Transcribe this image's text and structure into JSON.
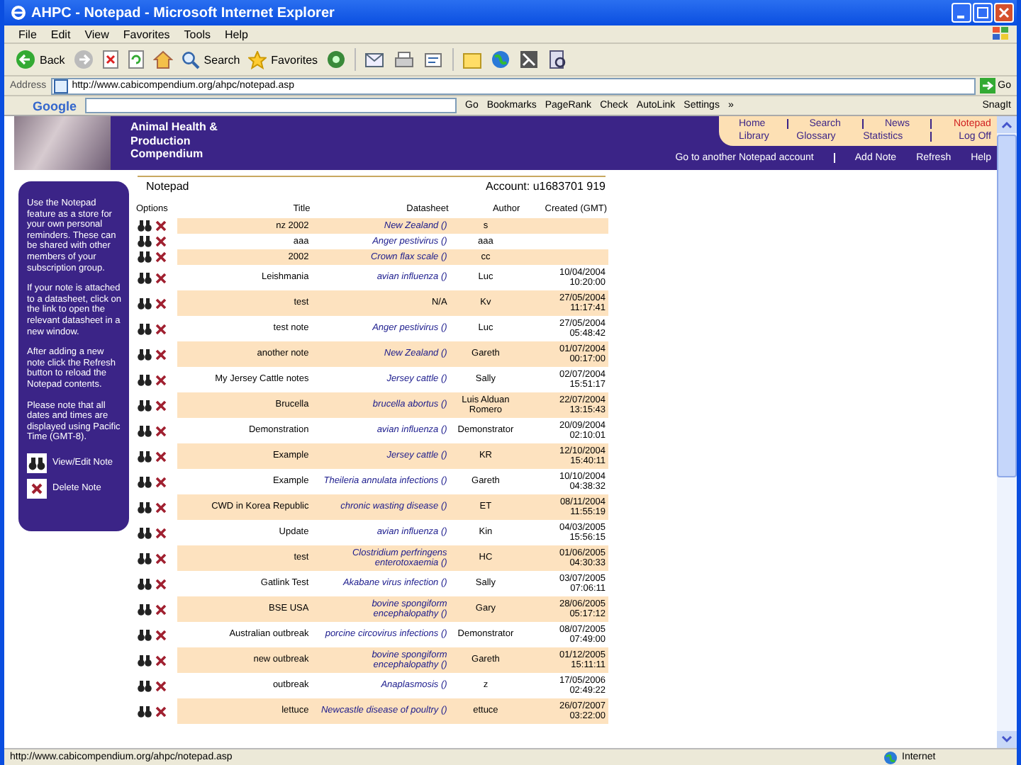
{
  "window": {
    "title": "AHPC - Notepad - Microsoft Internet Explorer"
  },
  "menu": [
    "File",
    "Edit",
    "View",
    "Favorites",
    "Tools",
    "Help"
  ],
  "toolbar": {
    "back": "Back",
    "search": "Search",
    "favorites": "Favorites"
  },
  "address": {
    "label": "Address",
    "url": "http://www.cabicompendium.org/ahpc/notepad.asp",
    "go": "Go"
  },
  "google_bar": {
    "logo": "Google",
    "go": "Go",
    "items": [
      "Bookmarks",
      "PageRank",
      "Check",
      "AutoLink",
      "Settings"
    ],
    "more": "»",
    "snagit": "SnagIt"
  },
  "site": {
    "name": "Animal Health & Production Compendium",
    "nav_top": [
      {
        "label": "Home",
        "selected": false
      },
      {
        "label": "Search",
        "selected": false
      },
      {
        "label": "News",
        "selected": false
      },
      {
        "label": "Notepad",
        "selected": true
      }
    ],
    "nav_bottom": [
      {
        "label": "Library",
        "selected": false
      },
      {
        "label": "Glossary",
        "selected": false
      },
      {
        "label": "Statistics",
        "selected": false
      },
      {
        "label": "Log Off",
        "selected": false
      }
    ],
    "actions": [
      "Go to another Notepad account",
      "Add Note",
      "Refresh",
      "Help"
    ]
  },
  "sidebar": {
    "paragraphs": [
      "Use the Notepad feature as a store for your own personal reminders. These can be shared with other members of your subscription group.",
      "If your note is attached to a datasheet, click on the link to open the relevant datasheet in a new window.",
      "After adding a new note click the Refresh button to reload the Notepad contents.",
      "Please note that all dates and times are displayed using Pacific Time (GMT-8)."
    ],
    "legend": {
      "view": "View/Edit Note",
      "delete": "Delete Note"
    }
  },
  "notepad": {
    "title": "Notepad",
    "account": "Account: u1683701 919",
    "columns": [
      "Options",
      "Title",
      "Datasheet",
      "Author",
      "Created (GMT)"
    ],
    "rows": [
      {
        "title": "nz 2002",
        "datasheet": "New Zealand ()",
        "linked": true,
        "author": "s",
        "created": ""
      },
      {
        "title": "aaa",
        "datasheet": "Anger pestivirus ()",
        "linked": true,
        "author": "aaa",
        "created": ""
      },
      {
        "title": "2002",
        "datasheet": "Crown flax scale ()",
        "linked": true,
        "author": "cc",
        "created": ""
      },
      {
        "title": "Leishmania",
        "datasheet": "avian influenza ()",
        "linked": true,
        "author": "Luc",
        "created": "10/04/2004 10:20:00"
      },
      {
        "title": "test",
        "datasheet": "N/A",
        "linked": false,
        "author": "Kv",
        "created": "27/05/2004 11:17:41"
      },
      {
        "title": "test note",
        "datasheet": "Anger pestivirus ()",
        "linked": true,
        "author": "Luc",
        "created": "27/05/2004 05:48:42"
      },
      {
        "title": "another note",
        "datasheet": "New Zealand ()",
        "linked": true,
        "author": "Gareth",
        "created": "01/07/2004 00:17:00"
      },
      {
        "title": "My Jersey Cattle notes",
        "datasheet": "Jersey cattle ()",
        "linked": true,
        "author": "Sally",
        "created": "02/07/2004 15:51:17"
      },
      {
        "title": "Brucella",
        "datasheet": "brucella abortus ()",
        "linked": true,
        "author": "Luis Alduan Romero",
        "created": "22/07/2004 13:15:43"
      },
      {
        "title": "Demonstration",
        "datasheet": "avian influenza ()",
        "linked": true,
        "author": "Demonstrator",
        "created": "20/09/2004 02:10:01"
      },
      {
        "title": "Example",
        "datasheet": "Jersey cattle ()",
        "linked": true,
        "author": "KR",
        "created": "12/10/2004 15:40:11"
      },
      {
        "title": "Example",
        "datasheet": "Theileria annulata infections ()",
        "linked": true,
        "author": "Gareth",
        "created": "10/10/2004 04:38:32"
      },
      {
        "title": "CWD in Korea Republic",
        "datasheet": "chronic wasting disease ()",
        "linked": true,
        "author": "ET",
        "created": "08/11/2004 11:55:19"
      },
      {
        "title": "Update",
        "datasheet": "avian influenza ()",
        "linked": true,
        "author": "Kin",
        "created": "04/03/2005 15:56:15"
      },
      {
        "title": "test",
        "datasheet": "Clostridium perfringens enterotoxaemia ()",
        "linked": true,
        "author": "HC",
        "created": "01/06/2005 04:30:33"
      },
      {
        "title": "Gatlink Test",
        "datasheet": "Akabane virus infection ()",
        "linked": true,
        "author": "Sally",
        "created": "03/07/2005 07:06:11"
      },
      {
        "title": "BSE USA",
        "datasheet": "bovine spongiform encephalopathy ()",
        "linked": true,
        "author": "Gary",
        "created": "28/06/2005 05:17:12"
      },
      {
        "title": "Australian outbreak",
        "datasheet": "porcine circovirus infections ()",
        "linked": true,
        "author": "Demonstrator",
        "created": "08/07/2005 07:49:00"
      },
      {
        "title": "new outbreak",
        "datasheet": "bovine spongiform encephalopathy ()",
        "linked": true,
        "author": "Gareth",
        "created": "01/12/2005 15:11:11"
      },
      {
        "title": "outbreak",
        "datasheet": "Anaplasmosis ()",
        "linked": true,
        "author": "z",
        "created": "17/05/2006 02:49:22"
      },
      {
        "title": "lettuce",
        "datasheet": "Newcastle disease of poultry ()",
        "linked": true,
        "author": "ettuce",
        "created": "26/07/2007 03:22:00"
      }
    ]
  },
  "status_bar": {
    "url": "http://www.cabicompendium.org/ahpc/notepad.asp",
    "zone": "Internet"
  }
}
